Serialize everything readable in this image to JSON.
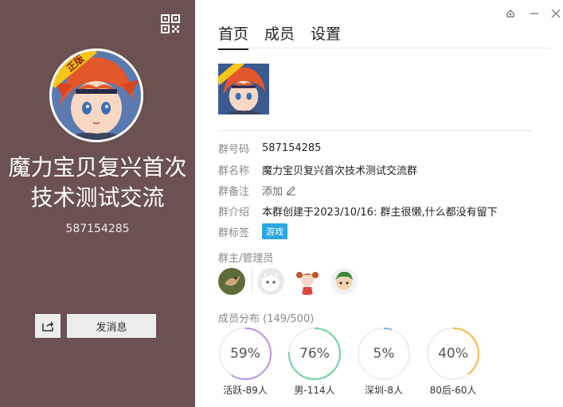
{
  "left": {
    "group_name": "魔力宝贝复兴首次技术测试交流",
    "group_id": "587154285",
    "send_label": "发消息",
    "avatar_badge": "正版"
  },
  "tabs": [
    "首页",
    "成员",
    "设置"
  ],
  "info": {
    "number_key": "群号码",
    "number_val": "587154285",
    "name_key": "群名称",
    "name_val": "魔力宝贝复兴首次技术测试交流群",
    "remark_key": "群备注",
    "remark_val": "添加",
    "intro_key": "群介绍",
    "intro_val": "本群创建于2023/10/16:  群主很懒,什么都没有留下",
    "tag_key": "群标签",
    "tag_val": "游戏"
  },
  "admins_label": "群主/管理员",
  "dist_label": "成员分布 (149/500)",
  "distribution": [
    {
      "pct_text": "59%",
      "label": "活跃-89人",
      "fraction": 0.59,
      "color": "#b794e0"
    },
    {
      "pct_text": "76%",
      "label": "男-114人",
      "fraction": 0.76,
      "color": "#6fd3a0"
    },
    {
      "pct_text": "5%",
      "label": "深圳-8人",
      "fraction": 0.05,
      "color": "#7fb8e8"
    },
    {
      "pct_text": "40%",
      "label": "80后-60人",
      "fraction": 0.4,
      "color": "#f5b942"
    }
  ]
}
